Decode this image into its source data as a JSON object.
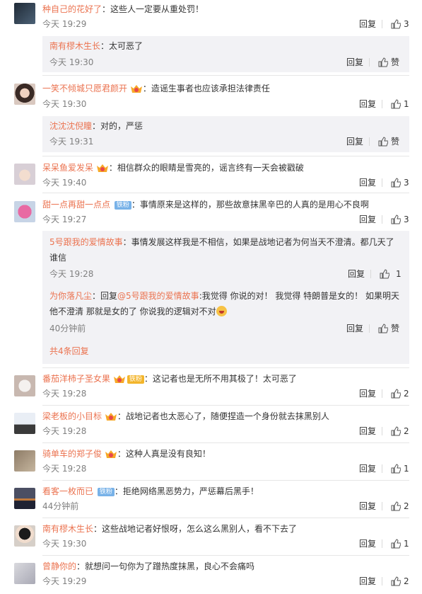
{
  "labels": {
    "reply": "回复",
    "like_zero": "赞",
    "more_replies": "共4条回复"
  },
  "colors": {
    "username": "#eb7350",
    "meta": "#808080",
    "subbox_bg": "#f2f2f5"
  },
  "comments": [
    {
      "user": "种自己的花好了",
      "text": "这些人一定要从重处罚！",
      "time": "今天 19:29",
      "likes": "3"
    },
    {
      "user": "一笑不倾城只愿君颜开",
      "text": "造谣生事者也应该承担法律责任",
      "time": "今天 19:30",
      "likes": "1"
    },
    {
      "user": "呆呆鱼爱发呆",
      "text": "相信群众的眼睛是雪亮的，谣言终有一天会被戳破",
      "time": "今天 19:40",
      "likes": "3"
    },
    {
      "user": "甜一点再甜一点点",
      "tag": "铁粉",
      "text": "事情原来是这样的，那些故意抹黑辛巴的人真的是用心不良啊",
      "time": "今天 19:27",
      "likes": "3"
    },
    {
      "user": "番茄洋柿子圣女果",
      "tag": "铁粉",
      "text": "这记者也是无所不用其极了！太可恶了",
      "time": "今天 19:28",
      "likes": "2"
    },
    {
      "user": "梁老板的小目标",
      "text": "战地记者也太恶心了，随便捏造一个身份就去抹黑别人",
      "time": "今天 19:28",
      "likes": "2"
    },
    {
      "user": "骑单车的郑子俊",
      "text": "这种人真是没有良知！",
      "time": "今天 19:28",
      "likes": "1"
    },
    {
      "user": "看客一枚而已",
      "tag": "铁粉",
      "text": "拒绝网络黑恶势力，严惩幕后黑手！",
      "time": "44分钟前",
      "likes": "2"
    },
    {
      "user": "南有樛木生长",
      "text": "这些战地记者好恨呀，怎么这么黑别人，看不下去了",
      "time": "今天 19:30",
      "likes": "1"
    },
    {
      "user": "曾静你的",
      "text": "就想问一句你为了蹭热度抹黑，良心不会痛吗",
      "time": "今天 19:29",
      "likes": "2"
    }
  ],
  "subs": [
    {
      "user": "南有樛木生长",
      "text": "太可恶了",
      "time": "今天 19:30",
      "likes": "赞"
    },
    {
      "user": "沈沈沈倪瞳",
      "text": "对的，严惩",
      "time": "今天 19:31",
      "likes": "赞"
    },
    {
      "user": "5号跟我的爱情故事",
      "text": "事情发展这样我是不相信，如果是战地记者为何当天不澄清。都几天了谁信",
      "time": "今天 19:28",
      "likes": "1"
    },
    {
      "user": "为你落凡尘",
      "prefix": "回复",
      "mention": "@5号跟我的爱情故事",
      "text": ":我觉得 你说的对！ 我觉得 特朗普是女的！ 如果明天他不澄清 那就是女的了 你说我的逻辑对不对",
      "time": "40分钟前",
      "likes": "赞"
    }
  ]
}
